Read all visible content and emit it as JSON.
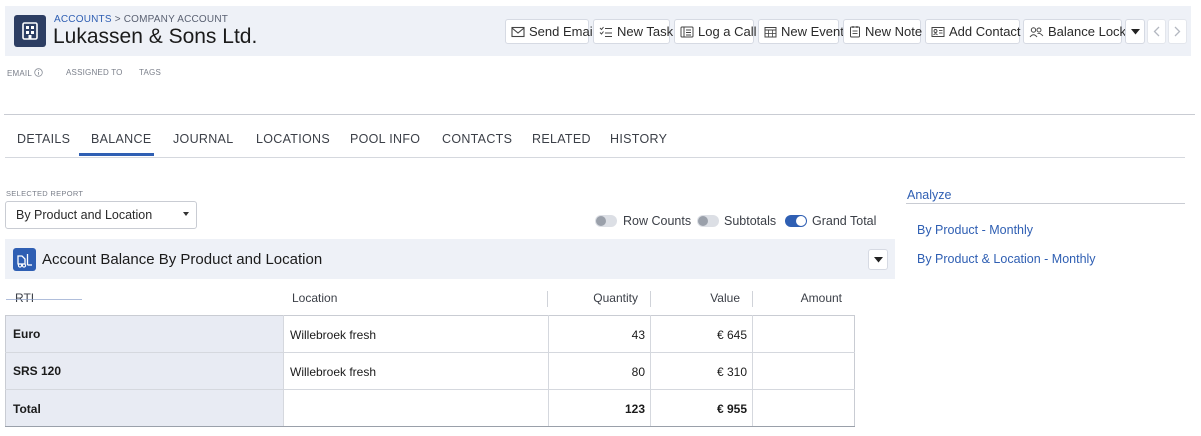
{
  "header": {
    "breadcrumb": {
      "parent": "ACCOUNTS",
      "separator": ">",
      "current": "COMPANY ACCOUNT"
    },
    "title": "Lukassen & Sons Ltd.",
    "actions": [
      {
        "label": "Send Email",
        "icon": "envelope-icon"
      },
      {
        "label": "New Task",
        "icon": "task-list-icon"
      },
      {
        "label": "Log a Call",
        "icon": "phone-log-icon"
      },
      {
        "label": "New Event",
        "icon": "calendar-icon"
      },
      {
        "label": "New Note",
        "icon": "note-icon"
      },
      {
        "label": "Add Contact",
        "icon": "contact-card-icon"
      },
      {
        "label": "Balance Lock",
        "icon": "users-lock-icon"
      }
    ]
  },
  "meta": {
    "email": "EMAIL",
    "assigned_to": "ASSIGNED TO",
    "tags": "TAGS"
  },
  "tabs": [
    {
      "label": "DETAILS"
    },
    {
      "label": "BALANCE",
      "active": true
    },
    {
      "label": "JOURNAL"
    },
    {
      "label": "LOCATIONS"
    },
    {
      "label": "POOL INFO"
    },
    {
      "label": "CONTACTS"
    },
    {
      "label": "RELATED"
    },
    {
      "label": "HISTORY"
    }
  ],
  "report": {
    "label": "SELECTED REPORT",
    "selected": "By Product and Location",
    "toggles": [
      {
        "label": "Row Counts",
        "on": false
      },
      {
        "label": "Subtotals",
        "on": false
      },
      {
        "label": "Grand Total",
        "on": true
      }
    ]
  },
  "panel": {
    "title": "Account Balance By Product and Location",
    "columns": [
      "RTI",
      "Location",
      "Quantity",
      "Value",
      "Amount"
    ],
    "rows": [
      {
        "rti": "Euro",
        "location": "Willebroek fresh",
        "quantity": "43",
        "value": "€ 645",
        "amount": ""
      },
      {
        "rti": "SRS 120",
        "location": "Willebroek fresh",
        "quantity": "80",
        "value": "€ 310",
        "amount": ""
      }
    ],
    "total": {
      "label": "Total",
      "location": "",
      "quantity": "123",
      "value": "€ 955",
      "amount": ""
    }
  },
  "analyze": {
    "title": "Analyze",
    "links": [
      "By Product - Monthly",
      "By Product & Location - Monthly"
    ]
  },
  "colors": {
    "accent": "#2f5fb3",
    "header_bg": "#eef1f7",
    "record_icon_bg": "#2d3e63"
  }
}
